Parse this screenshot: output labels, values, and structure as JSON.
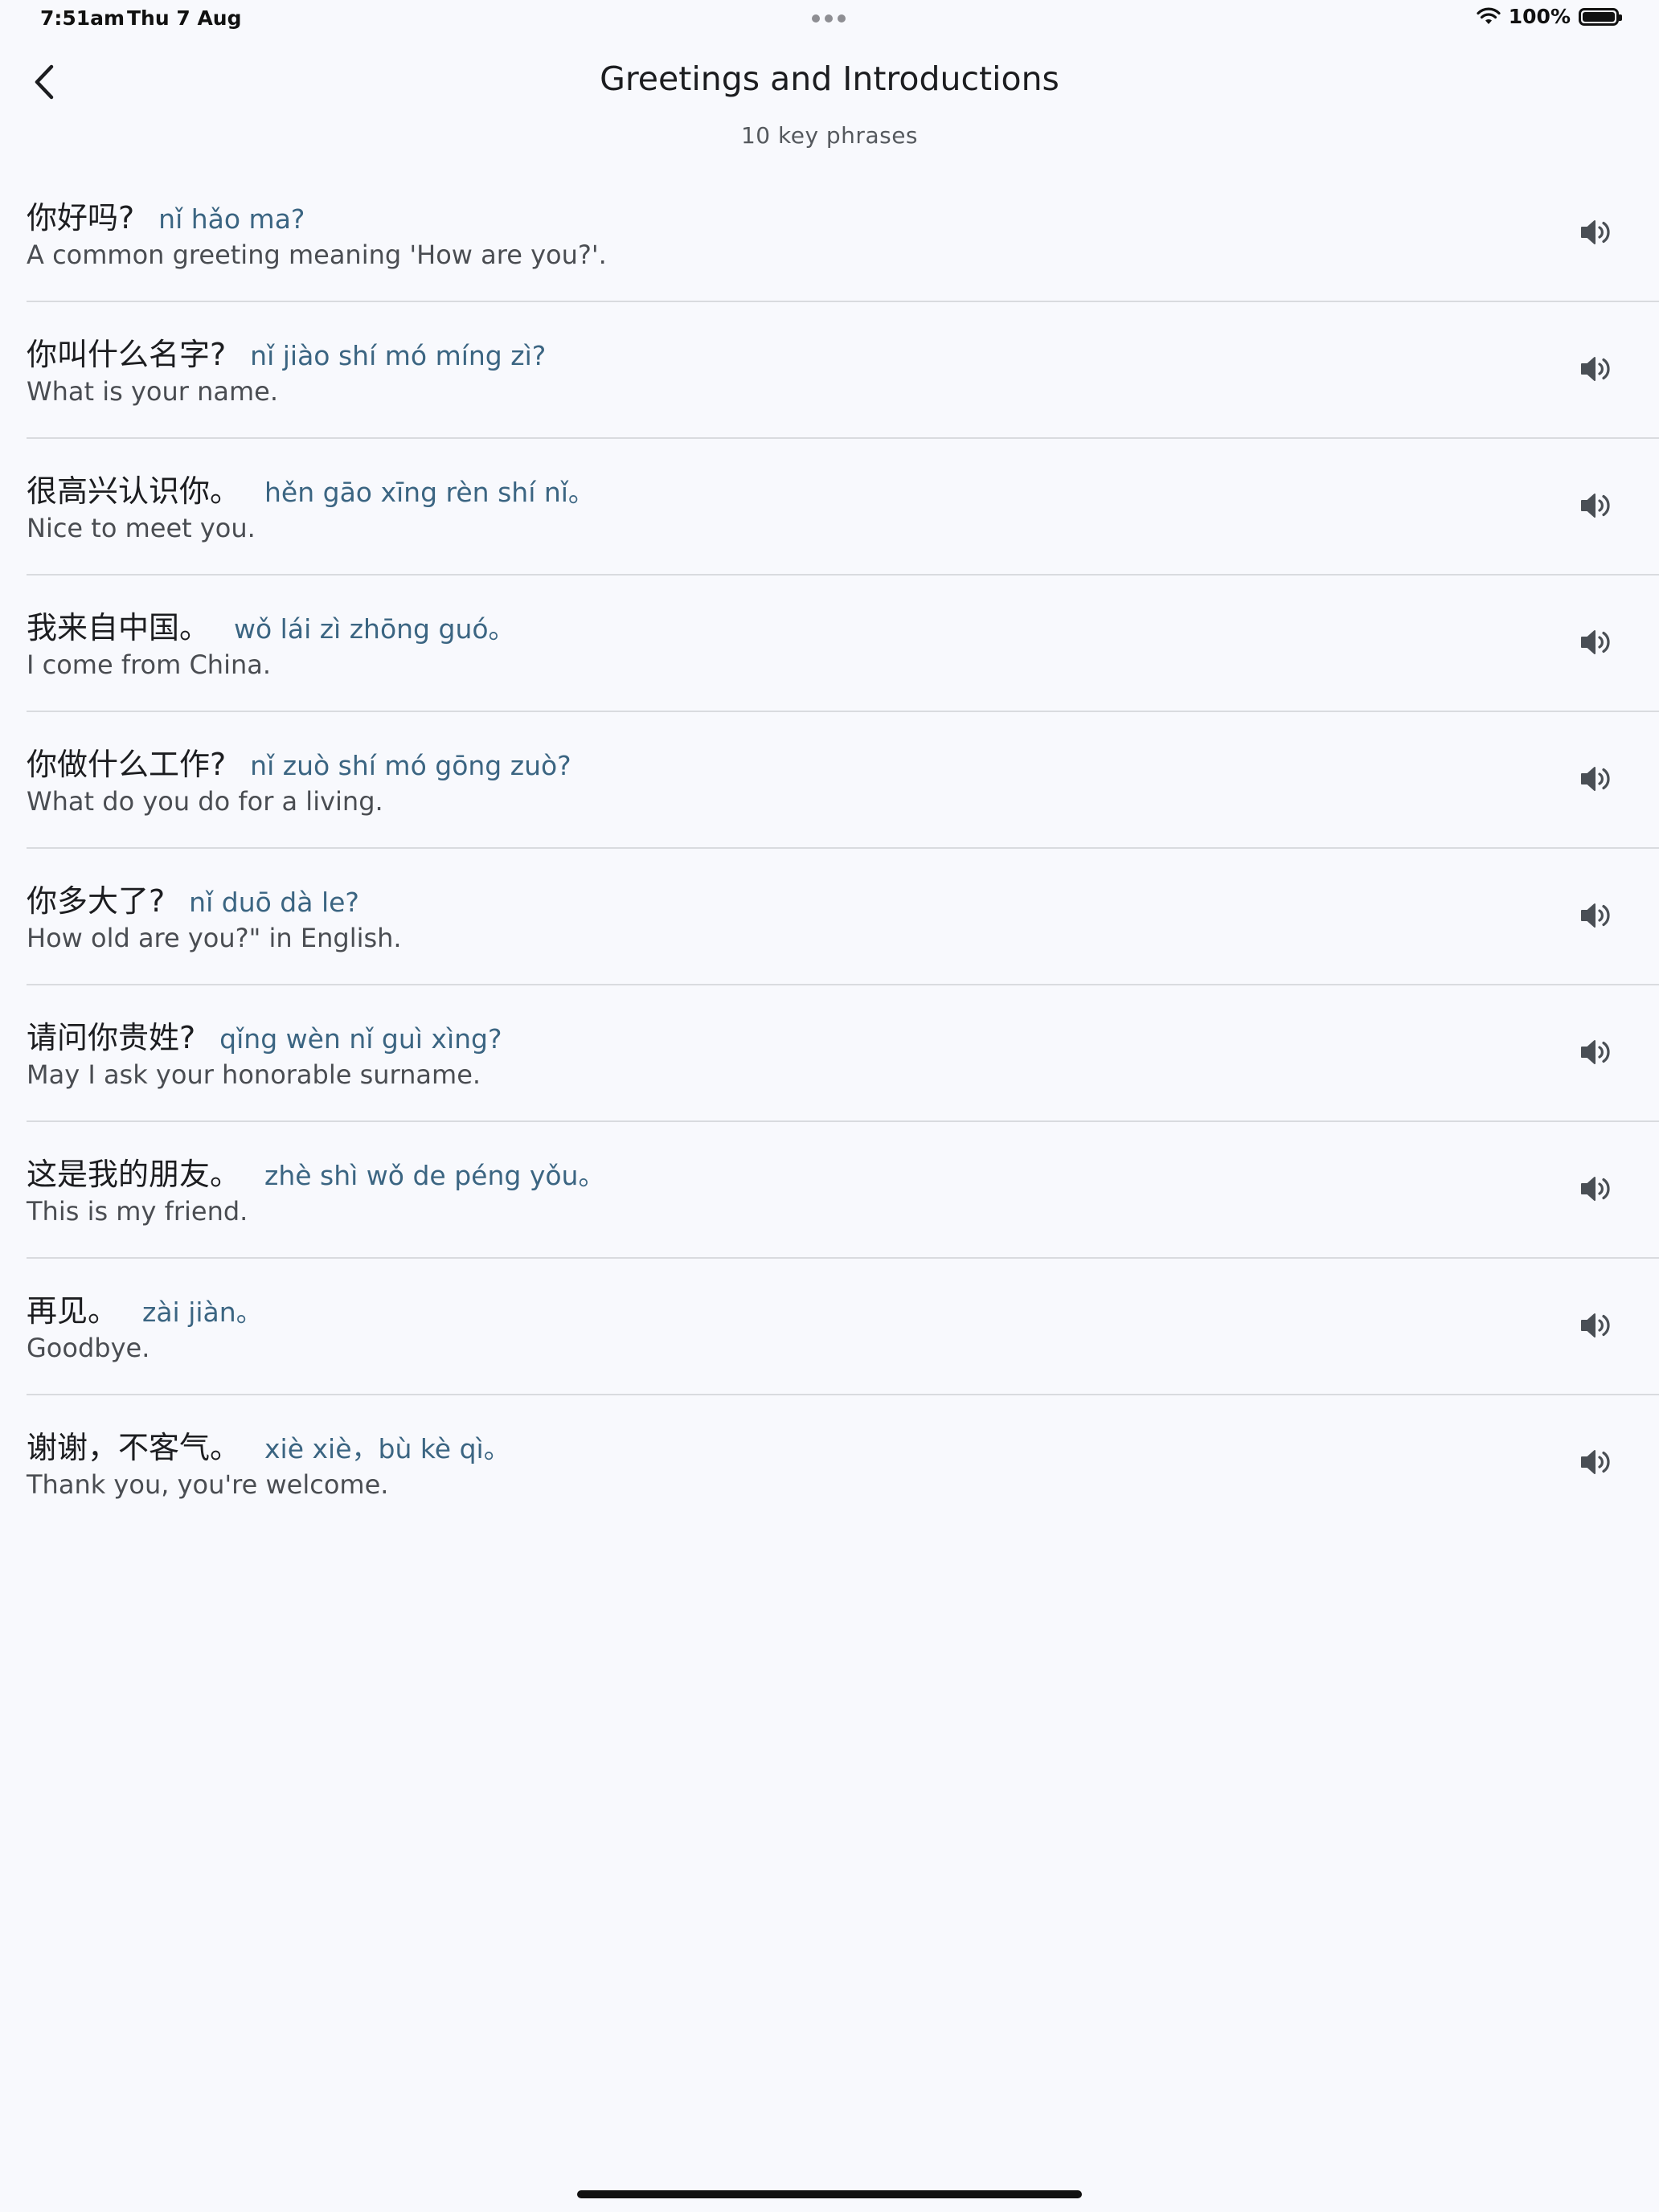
{
  "status_bar": {
    "time": "7:51am",
    "date": "Thu 7 Aug",
    "battery_percent": "100%",
    "battery_level": 1.0
  },
  "header": {
    "title": "Greetings and Introductions",
    "subtitle": "10 key phrases"
  },
  "phrases": [
    {
      "hanzi": "你好吗?",
      "pinyin": "nǐ hǎo ma?",
      "meaning": "A common greeting meaning 'How are you?'."
    },
    {
      "hanzi": "你叫什么名字?",
      "pinyin": "nǐ jiào shí mó míng zì?",
      "meaning": "What is your name."
    },
    {
      "hanzi": "很高兴认识你。",
      "pinyin": "hěn gāo xīng rèn shí nǐ。",
      "meaning": "Nice to meet you."
    },
    {
      "hanzi": "我来自中国。",
      "pinyin": "wǒ lái zì zhōng guó。",
      "meaning": "I come from China."
    },
    {
      "hanzi": "你做什么工作?",
      "pinyin": "nǐ zuò shí mó gōng zuò?",
      "meaning": "What do you do for a living."
    },
    {
      "hanzi": "你多大了?",
      "pinyin": "nǐ duō dà le?",
      "meaning": "How old are you?\" in English."
    },
    {
      "hanzi": "请问你贵姓?",
      "pinyin": "qǐng wèn nǐ guì xìng?",
      "meaning": "May I ask your honorable surname."
    },
    {
      "hanzi": "这是我的朋友。",
      "pinyin": "zhè shì wǒ de péng yǒu。",
      "meaning": "This is my friend."
    },
    {
      "hanzi": "再见。",
      "pinyin": "zài jiàn。",
      "meaning": "Goodbye."
    },
    {
      "hanzi": "谢谢，不客气。",
      "pinyin": "xiè xiè，bù kè qì。",
      "meaning": "Thank you, you're welcome."
    }
  ],
  "icons": {
    "back": "chevron-left-icon",
    "speaker": "speaker-icon",
    "wifi": "wifi-icon",
    "battery": "battery-icon"
  },
  "colors": {
    "background": "#f8f9fd",
    "pinyin": "#3b6582",
    "divider": "#d9dbdf",
    "icon": "#4a4f55"
  }
}
